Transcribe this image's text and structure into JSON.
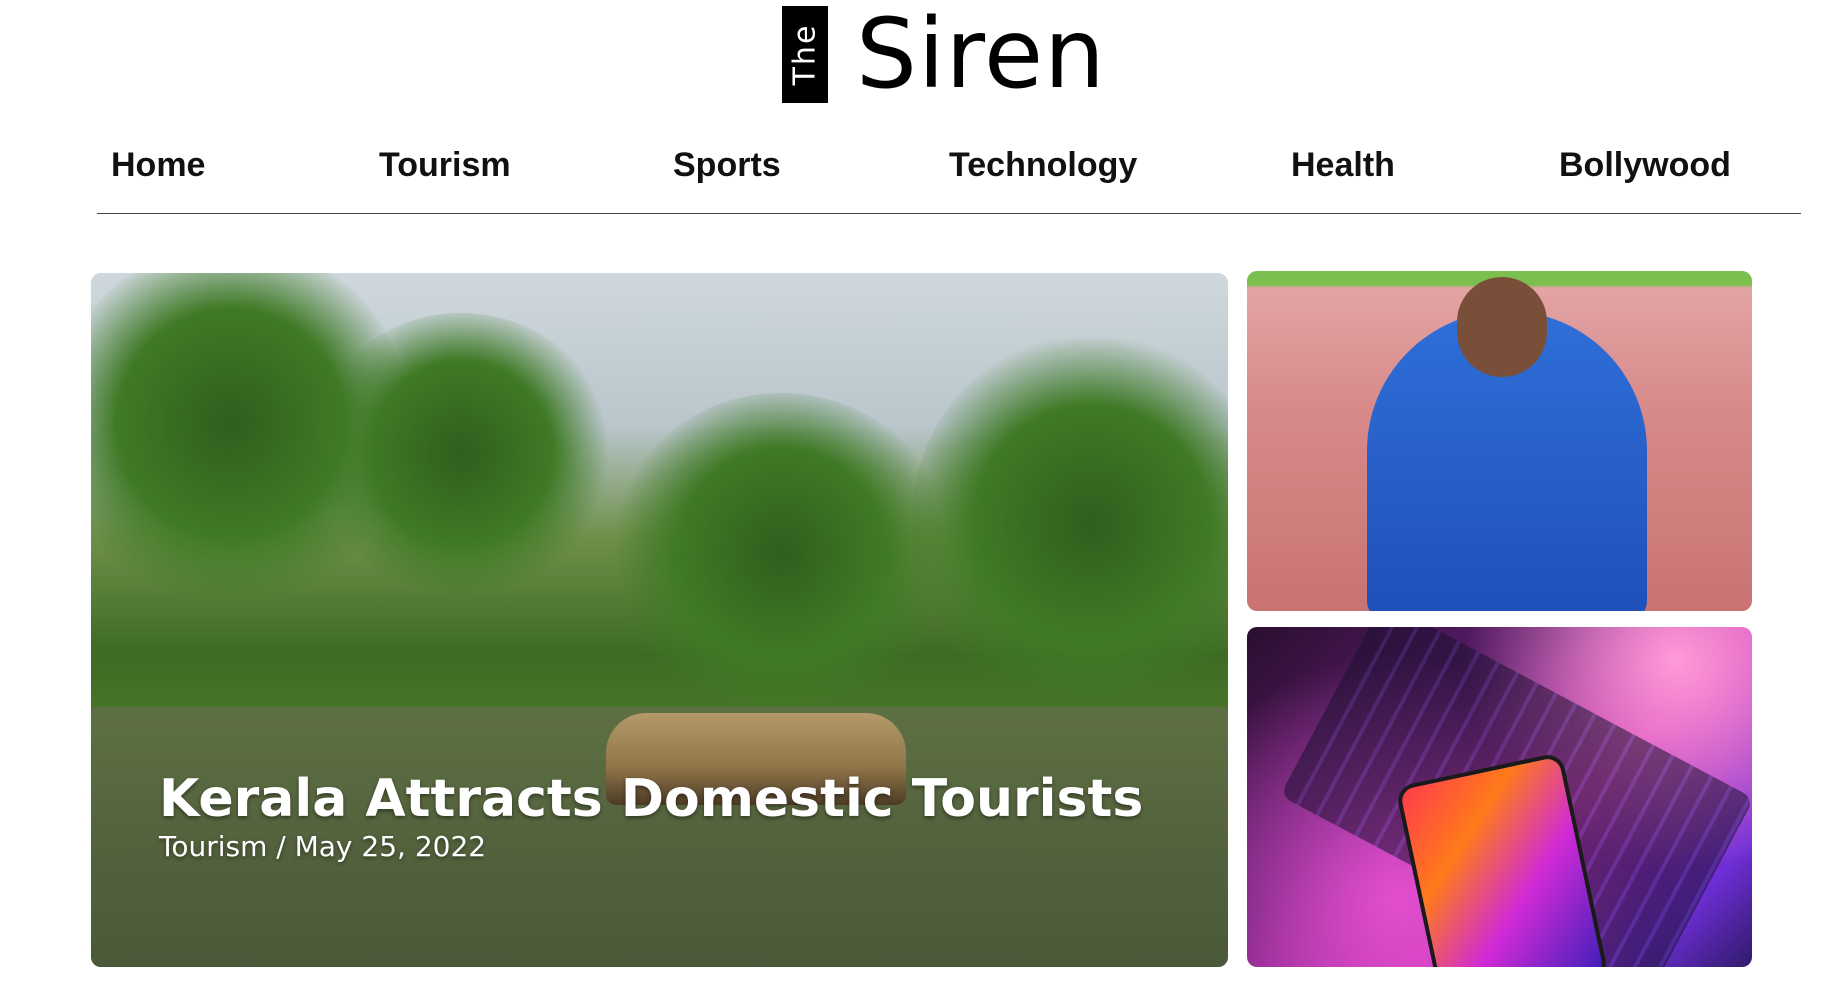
{
  "logo": {
    "the": "The",
    "name": "Siren"
  },
  "nav": {
    "items": [
      {
        "label": "Home"
      },
      {
        "label": "Tourism"
      },
      {
        "label": "Sports"
      },
      {
        "label": "Technology"
      },
      {
        "label": "Health"
      },
      {
        "label": "Bollywood"
      }
    ]
  },
  "featured": {
    "title": "Kerala Attracts Domestic Tourists",
    "meta": "Tourism / May 25, 2022",
    "image": "kerala-backwaters-houseboat-photo"
  },
  "side_cards": [
    {
      "image": "athlete-with-medal-photo"
    },
    {
      "image": "laptop-phone-earbuds-photo"
    }
  ],
  "colors": {
    "nav_text": "#111111",
    "divider": "#444444",
    "logo_box": "#000000"
  }
}
